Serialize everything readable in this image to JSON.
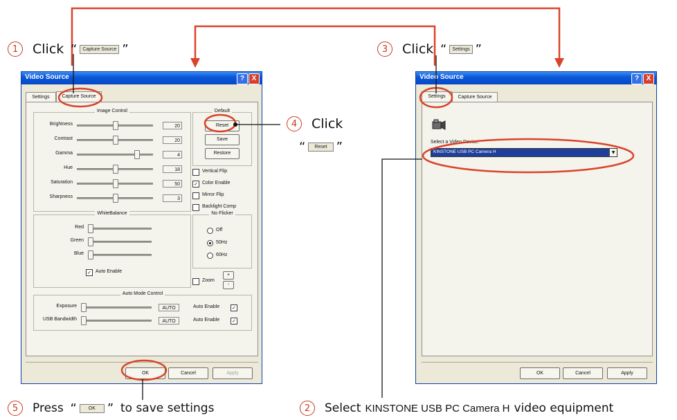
{
  "steps": {
    "step1": {
      "number": "1",
      "verb": "Click",
      "button": "Capture Source"
    },
    "step2": {
      "number": "2",
      "text_before": "Select",
      "device": "KINSTONE USB PC Camera H",
      "text_after": "video equipment"
    },
    "step3": {
      "number": "3",
      "verb": "Click",
      "button": "Settings"
    },
    "step4": {
      "number": "4",
      "verb": "Click",
      "button": "Reset"
    },
    "step5": {
      "number": "5",
      "verb": "Press",
      "button": "OK",
      "text_after": "to save settings"
    }
  },
  "colors": {
    "callout": "#d9432a",
    "xp_title": "#0a58d8",
    "dialog_bg": "#ece9d8"
  },
  "left_window": {
    "title": "Video Source",
    "help_icon": "?",
    "close_icon": "X",
    "tabs": [
      "Settings",
      "Capture Source"
    ],
    "image_control": {
      "label": "Image Control",
      "rows": [
        {
          "label": "Brightness",
          "value": "20",
          "level": 0.5
        },
        {
          "label": "Contrast",
          "value": "20",
          "level": 0.5
        },
        {
          "label": "Gamma",
          "value": "4",
          "level": 0.8
        },
        {
          "label": "Hue",
          "value": "18",
          "level": 0.5
        },
        {
          "label": "Saturation",
          "value": "50",
          "level": 0.5
        },
        {
          "label": "Sharpness",
          "value": "3",
          "level": 0.5
        }
      ]
    },
    "default": {
      "label": "Default",
      "reset": "Reset",
      "save": "Save",
      "restore": "Restore"
    },
    "checkboxes": [
      {
        "label": "Vertical Flip",
        "checked": false
      },
      {
        "label": "Color Enable",
        "checked": true
      },
      {
        "label": "Mirror Flip",
        "checked": false
      },
      {
        "label": "Backlight Comp",
        "checked": false
      }
    ],
    "white_balance": {
      "label": "WhiteBalance",
      "rows": [
        {
          "label": "Red",
          "level": 0.0
        },
        {
          "label": "Green",
          "level": 0.0
        },
        {
          "label": "Blue",
          "level": 0.0
        }
      ],
      "auto_enable": "Auto Enable",
      "auto_enable_checked": true
    },
    "no_flicker": {
      "label": "No Flicker",
      "options": [
        "Off",
        "50Hz",
        "60Hz"
      ],
      "selected": "50Hz"
    },
    "zoom": {
      "label": "Zoom",
      "plus": "+",
      "minus": "-"
    },
    "auto_mode": {
      "label": "Auto Mode Control",
      "rows": [
        {
          "label": "Exposure",
          "value": "AUTO",
          "enable": "Auto Enable",
          "checked": true,
          "level": 0.0
        },
        {
          "label": "USB Bandwidth",
          "value": "AUTO",
          "enable": "Auto Enable",
          "checked": true,
          "level": 0.0
        }
      ]
    },
    "buttons": {
      "ok": "OK",
      "cancel": "Cancel",
      "apply": "Apply"
    }
  },
  "right_window": {
    "title": "Video Source",
    "help_icon": "?",
    "close_icon": "X",
    "tabs": [
      "Settings",
      "Capture Source"
    ],
    "device_icon": "camera-icon",
    "select_label": "Select a Video Device:",
    "selected_device": "KINSTONE USB PC Camera H",
    "buttons": {
      "ok": "OK",
      "cancel": "Cancel",
      "apply": "Apply"
    }
  }
}
